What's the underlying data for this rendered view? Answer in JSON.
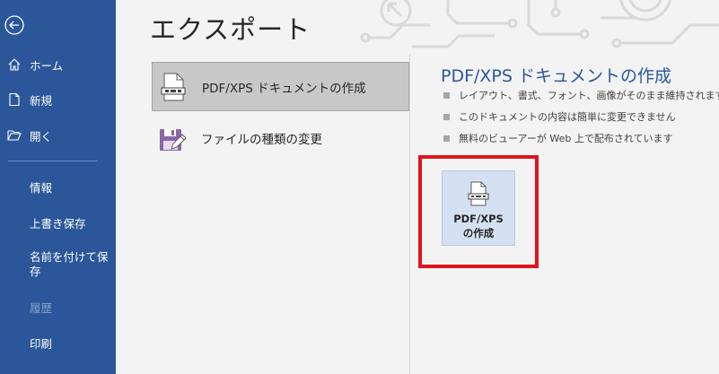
{
  "sidebar": {
    "items": [
      {
        "label": "ホーム"
      },
      {
        "label": "新規"
      },
      {
        "label": "開く"
      },
      {
        "label": "情報"
      },
      {
        "label": "上書き保存"
      },
      {
        "label": "名前を付けて保存"
      },
      {
        "label": "履歴"
      },
      {
        "label": "印刷"
      }
    ]
  },
  "main": {
    "title": "エクスポート",
    "options": [
      {
        "label": "PDF/XPS ドキュメントの作成"
      },
      {
        "label": "ファイルの種類の変更"
      }
    ],
    "detail": {
      "title": "PDF/XPS ドキュメントの作成",
      "bullets": [
        "レイアウト、書式、フォント、画像がそのまま維持されます",
        "このドキュメントの内容は簡単に変更できません",
        "無料のビューアーが Web 上で配布されています"
      ],
      "button_line1": "PDF/XPS",
      "button_line2": "の作成"
    }
  },
  "colors": {
    "sidebar": "#2b579a",
    "accent": "#2b579a",
    "highlight": "#e0141e"
  }
}
